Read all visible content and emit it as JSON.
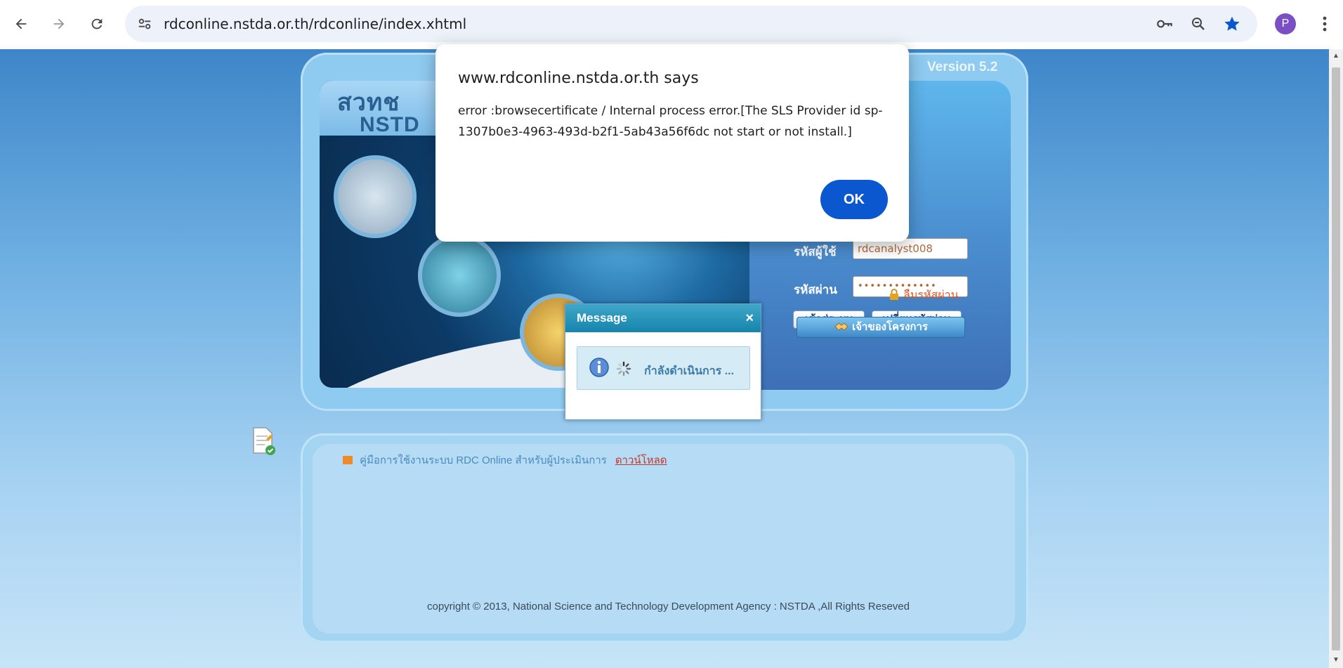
{
  "browser": {
    "url": "rdconline.nstda.or.th/rdconline/index.xhtml",
    "profile_initial": "P",
    "icons": [
      "back-icon",
      "forward-icon",
      "reload-icon",
      "site-settings-icon",
      "password-key-icon",
      "zoom-icon",
      "bookmark-star-icon",
      "menu-icon"
    ]
  },
  "alert": {
    "title": "www.rdconline.nstda.or.th says",
    "message": "error :browsecertificate / Internal process error.[The SLS Provider id sp-1307b0e3-4963-493d-b2f1-5ab43a56f6dc not start or not install.]",
    "ok_label": "OK"
  },
  "login": {
    "version": "Version 5.2",
    "logo_text": "สวทช NSTDA",
    "username_label": "รหัสผู้ใช้",
    "username_value": "rdcanalyst008",
    "password_label": "รหัสผ่าน",
    "password_value": "•••••••••••••",
    "login_button": "เข้าสู่ระบบ",
    "change_password_button": "เปลี่ยนรหัสผ่าน",
    "forgot_password": "ลืมรหัสผ่าน",
    "project_owner_button": "เจ้าของโครงการ"
  },
  "message_dialog": {
    "title": "Message",
    "close": "×",
    "text": "กำลังดำเนินการ ..."
  },
  "lower": {
    "manual_text": "คู่มือการใช้งานระบบ RDC Online สำหรับผู้ประเมินการ",
    "manual_link": "ดาวน์โหลด"
  },
  "footer": "copyright © 2013, National Science and Technology Development Agency : NSTDA ,All Rights Reseved",
  "colors": {
    "accent": "#0b57d0",
    "page_background": "#6fb0e2",
    "dialog_header": "#1684ac"
  }
}
